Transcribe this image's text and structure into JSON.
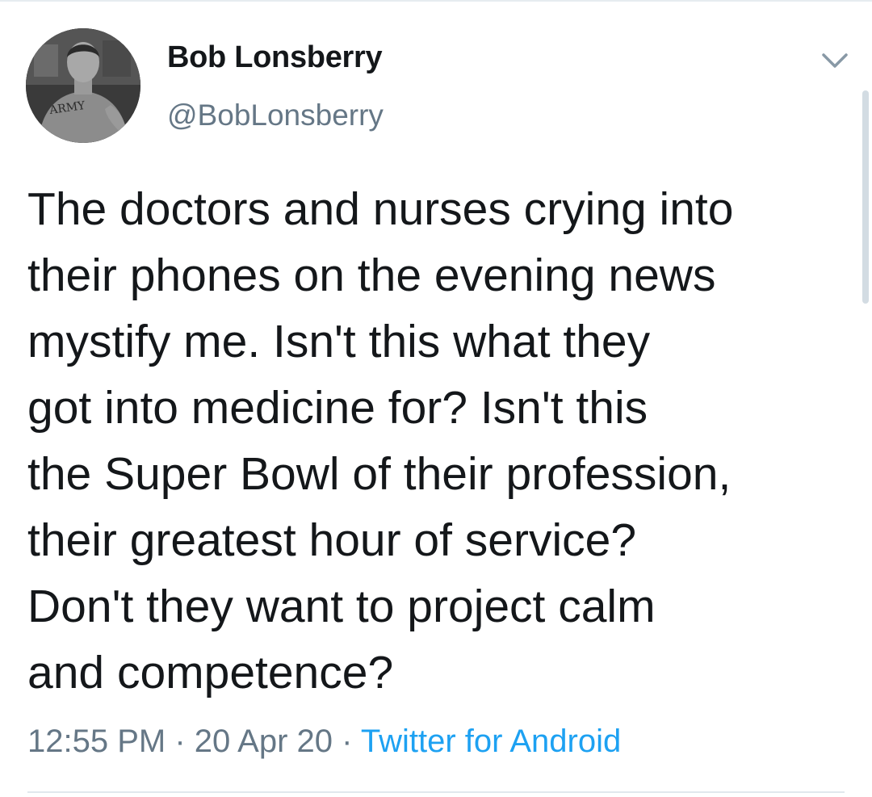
{
  "author": {
    "display_name": "Bob Lonsberry",
    "handle": "@BobLonsberry",
    "avatar_icon": "profile-photo",
    "avatar_shirt_text": "ARMY"
  },
  "tweet": {
    "text": "The doctors and nurses crying into\ntheir phones on the evening news\nmystify me. Isn't this what they\ngot into medicine for? Isn't this\nthe Super Bowl of their profession,\ntheir greatest hour of service?\nDon't they want to project calm\nand competence?"
  },
  "meta": {
    "time": "12:55 PM",
    "date": "20 Apr 20",
    "separator": " · ",
    "source": "Twitter for Android"
  },
  "menu": {
    "icon": "chevron-down-icon"
  },
  "colors": {
    "text": "#14171a",
    "secondary": "#657786",
    "link": "#1da1f2"
  }
}
